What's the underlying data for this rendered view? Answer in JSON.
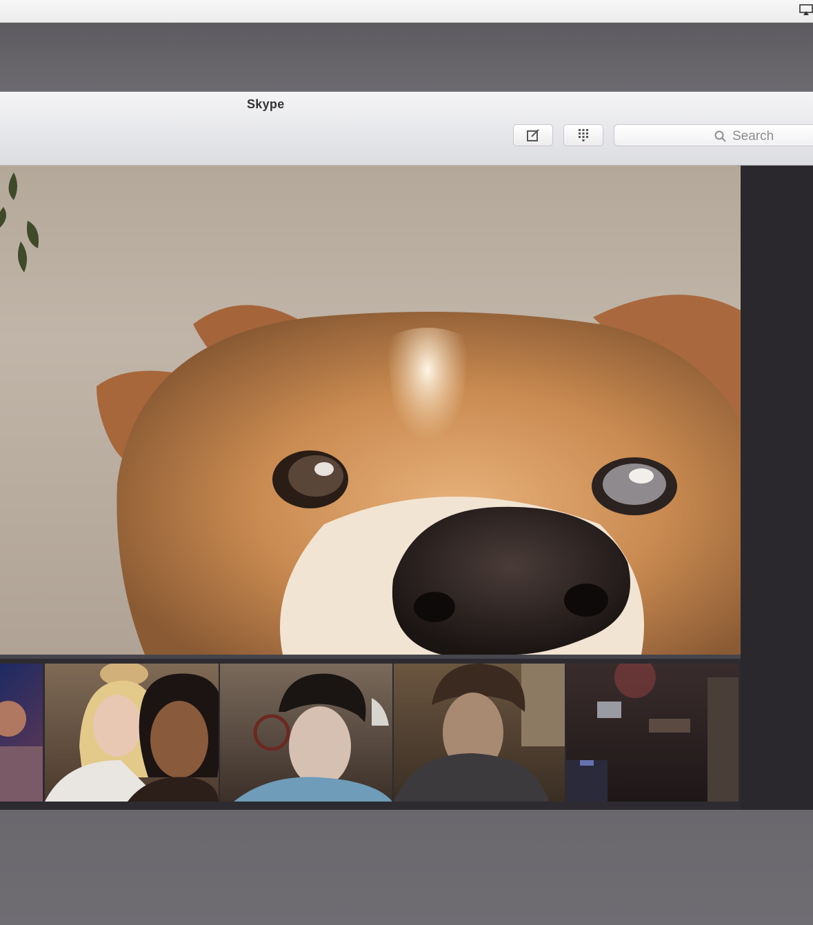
{
  "window": {
    "title": "Skype"
  },
  "toolbar": {
    "compose_icon": "compose-icon",
    "dialpad_icon": "dialpad-icon",
    "search_placeholder": "Search"
  },
  "call": {
    "main_feed": "dog-closeup-video",
    "participants": [
      {
        "id": "participant-1"
      },
      {
        "id": "participant-2"
      },
      {
        "id": "participant-3"
      },
      {
        "id": "participant-4"
      },
      {
        "id": "participant-5"
      }
    ]
  },
  "colors": {
    "window_bg": "#6b696e",
    "titlebar": "#e6e7ea",
    "call_bg": "#2a282d"
  }
}
